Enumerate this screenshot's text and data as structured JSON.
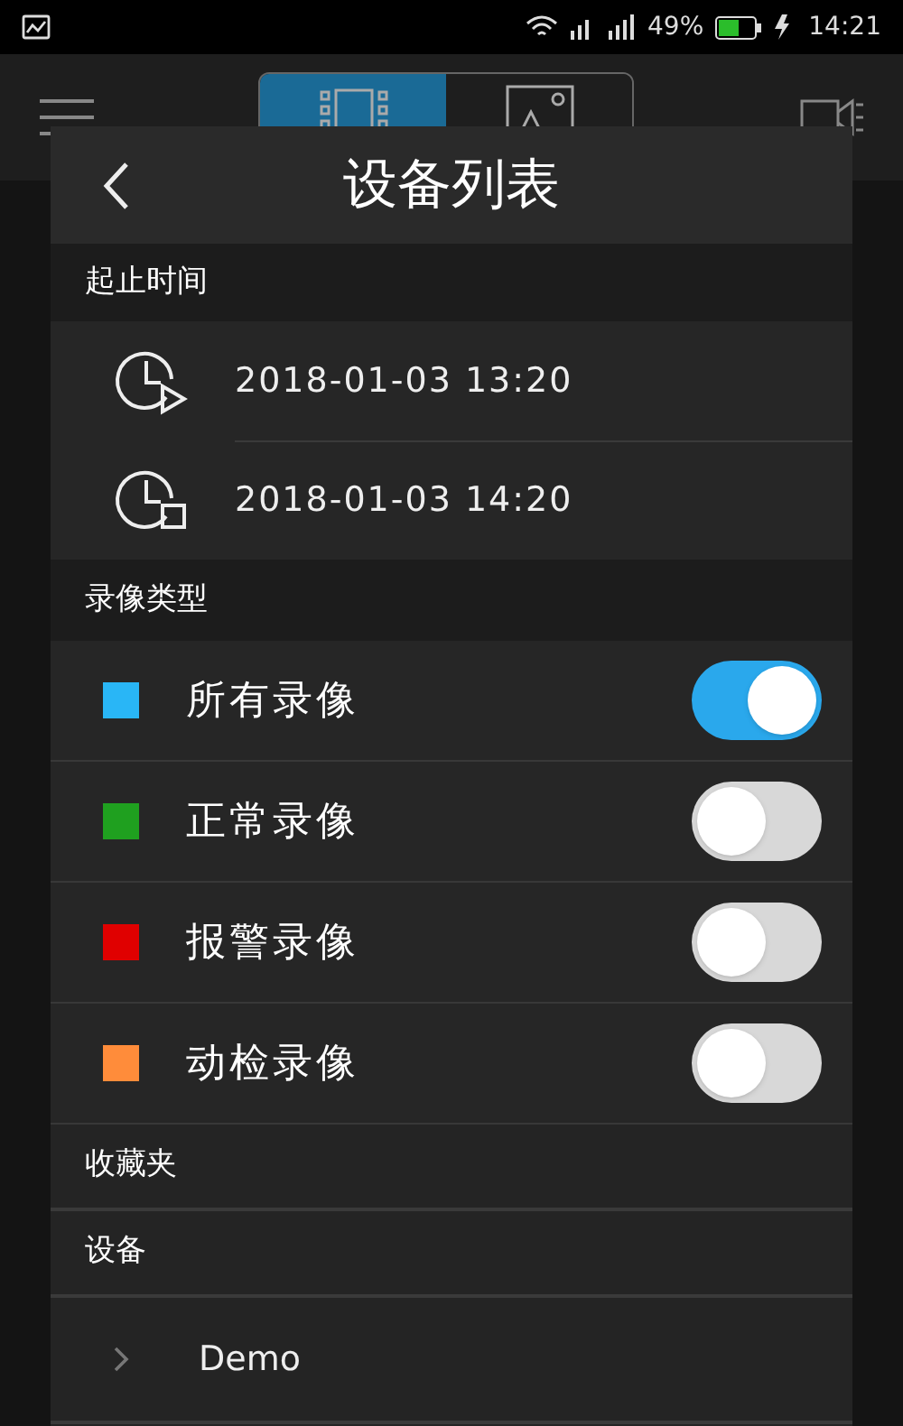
{
  "status_bar": {
    "battery": "49%",
    "time": "14:21"
  },
  "app_bar": {
    "tabs": [
      {
        "kind": "video",
        "selected": true
      },
      {
        "kind": "photo",
        "selected": false
      }
    ]
  },
  "dialog": {
    "title": "设备列表",
    "time_section": {
      "header": "起止时间",
      "rows": [
        {
          "kind": "start",
          "value": "2018-01-03 13:20"
        },
        {
          "kind": "end",
          "value": "2018-01-03 14:20"
        }
      ]
    },
    "type_section": {
      "header": "录像类型",
      "items": [
        {
          "label": "所有录像",
          "color": "#29b6f6",
          "on": true
        },
        {
          "label": "正常录像",
          "color": "#1fa01f",
          "on": false
        },
        {
          "label": "报警录像",
          "color": "#e00000",
          "on": false
        },
        {
          "label": "动检录像",
          "color": "#ff8c3a",
          "on": false
        }
      ]
    },
    "favorites": {
      "header": "收藏夹"
    },
    "devices": {
      "header": "设备",
      "items": [
        {
          "name": "Demo",
          "expanded": false
        }
      ]
    }
  }
}
